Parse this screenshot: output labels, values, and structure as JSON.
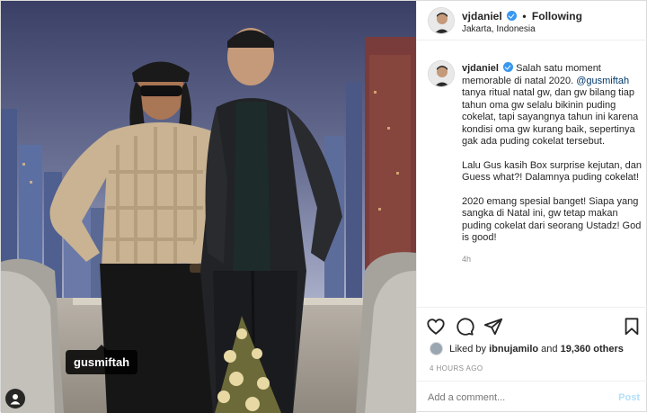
{
  "header": {
    "username": "vjdaniel",
    "separator": "•",
    "follow_status": "Following",
    "location": "Jakarta, Indonesia"
  },
  "photo": {
    "tag_username": "gusmiftah",
    "tag_icon": "person-icon"
  },
  "caption": {
    "username": "vjdaniel",
    "line1_before": "Salah satu moment memorable di natal 2020.",
    "mention": "@gusmiftah",
    "line1_after": "tanya ritual natal gw, dan gw bilang tiap tahun oma gw selalu bikinin puding cokelat, tapi sayangnya tahun ini karena kondisi oma gw kurang baik, sepertinya gak ada puding cokelat tersebut.",
    "para2": "Lalu Gus kasih Box surprise kejutan, dan Guess what?! Dalamnya puding cokelat!",
    "para3": "2020 emang spesial banget! Siapa yang sangka di Natal ini, gw tetap makan puding cokelat dari seorang Ustadz! God is good!",
    "time": "4h"
  },
  "actions": {
    "icons": [
      "heart-icon",
      "comment-icon",
      "share-icon",
      "bookmark-icon"
    ],
    "liked_by_prefix": "Liked by",
    "liked_by_user": "ibnujamilo",
    "liked_by_and": "and",
    "liked_by_count": "19,360 others",
    "time_ago": "4 HOURS AGO"
  },
  "comment": {
    "placeholder": "Add a comment...",
    "post_label": "Post"
  },
  "colors": {
    "verified": "#3897f0",
    "mention": "#00376b",
    "post_disabled": "#b2dffc",
    "muted": "#8e8e8e"
  }
}
